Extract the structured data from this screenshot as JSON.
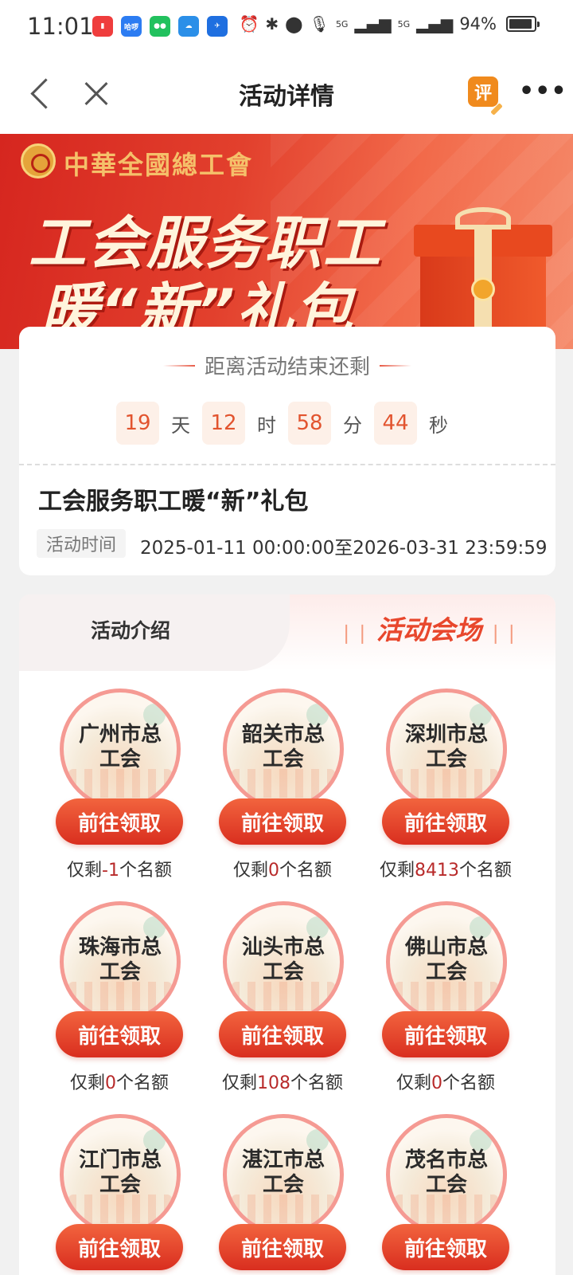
{
  "status_bar": {
    "time": "11:01",
    "apps": [
      {
        "icon": "app-red-icon",
        "color": "#ef3d3d",
        "label": ""
      },
      {
        "icon": "app-blue-text-icon",
        "color": "#2c7cf2",
        "label": "哈啰"
      },
      {
        "icon": "wechat-icon",
        "color": "#22c15e",
        "label": ""
      },
      {
        "icon": "cloud-icon",
        "color": "#2b8fe8",
        "label": ""
      },
      {
        "icon": "app-blue-orange-icon",
        "color": "#1f6fe0",
        "label": ""
      }
    ],
    "signal1": "5G",
    "signal2": "5G",
    "battery": "94%"
  },
  "nav": {
    "title": "活动详情",
    "review_label": "评"
  },
  "banner": {
    "logo_text": "中華全國總工會",
    "line1": "工会服务职工",
    "line2": "暖“新”礼包"
  },
  "countdown": {
    "title": "距离活动结束还剩",
    "items": [
      {
        "value": "19",
        "unit": "天"
      },
      {
        "value": "12",
        "unit": "时"
      },
      {
        "value": "58",
        "unit": "分"
      },
      {
        "value": "44",
        "unit": "秒"
      }
    ]
  },
  "activity": {
    "name": "工会服务职工暖“新”礼包",
    "time_label": "活动时间",
    "time_value": "2025-01-11 00:00:00至2026-03-31 23:59:59"
  },
  "tabs": {
    "intro": "活动介绍",
    "venue": "活动会场"
  },
  "venues": {
    "button_label": "前往领取",
    "quota_prefix": "仅剩",
    "quota_suffix": "个名额",
    "items": [
      {
        "line1": "广州市总",
        "line2": "工会",
        "quota": "-1"
      },
      {
        "line1": "韶关市总",
        "line2": "工会",
        "quota": "0"
      },
      {
        "line1": "深圳市总",
        "line2": "工会",
        "quota": "8413"
      },
      {
        "line1": "珠海市总",
        "line2": "工会",
        "quota": "0"
      },
      {
        "line1": "汕头市总",
        "line2": "工会",
        "quota": "108"
      },
      {
        "line1": "佛山市总",
        "line2": "工会",
        "quota": "0"
      },
      {
        "line1": "江门市总",
        "line2": "工会",
        "quota": ""
      },
      {
        "line1": "湛江市总",
        "line2": "工会",
        "quota": ""
      },
      {
        "line1": "茂名市总",
        "line2": "工会",
        "quota": ""
      }
    ]
  },
  "colors": {
    "accent": "#e8472d",
    "button": "#d92e1f",
    "quota_number": "#b82a2a"
  }
}
